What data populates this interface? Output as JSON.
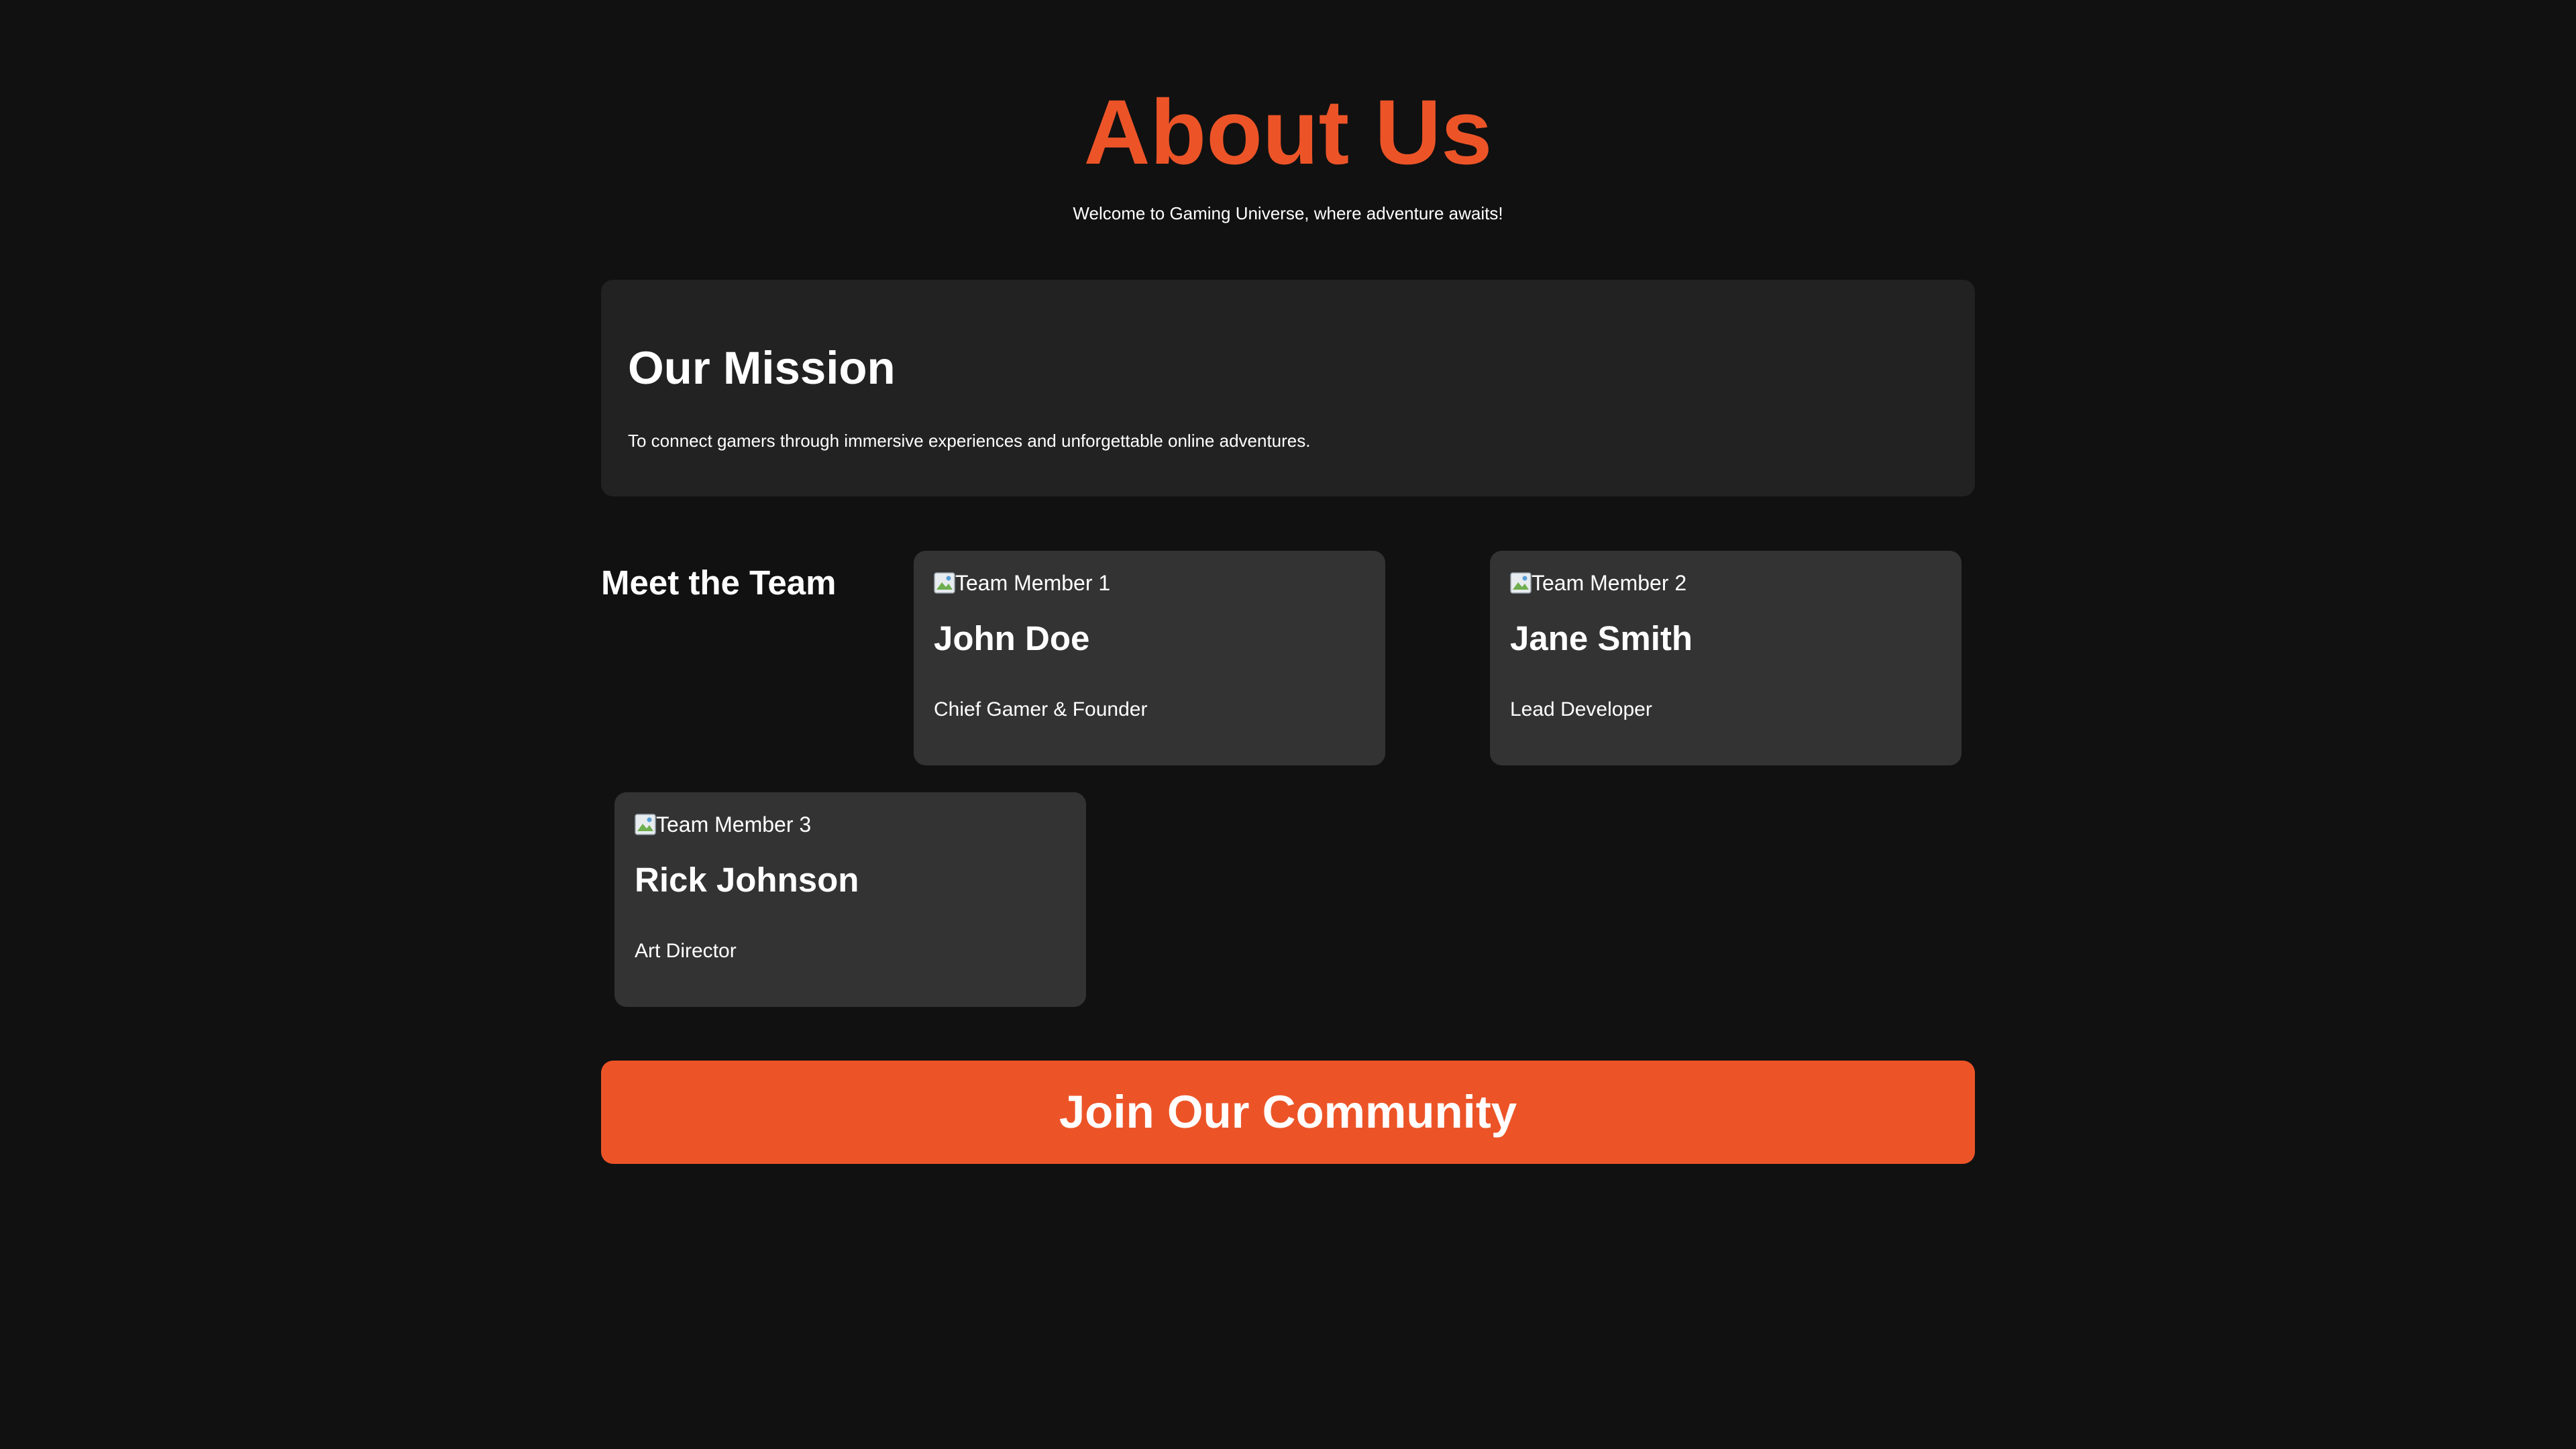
{
  "header": {
    "title": "About Us",
    "subtitle": "Welcome to Gaming Universe, where adventure awaits!"
  },
  "mission": {
    "heading": "Our Mission",
    "text": "To connect gamers through immersive experiences and unforgettable online adventures."
  },
  "team": {
    "heading": "Meet the Team",
    "members": [
      {
        "image_alt": "Team Member 1",
        "name": "John Doe",
        "role": "Chief Gamer & Founder"
      },
      {
        "image_alt": "Team Member 2",
        "name": "Jane Smith",
        "role": "Lead Developer"
      },
      {
        "image_alt": "Team Member 3",
        "name": "Rick Johnson",
        "role": "Art Director"
      }
    ]
  },
  "cta": {
    "label": "Join Our Community"
  },
  "colors": {
    "background": "#111111",
    "accent": "#ec5428",
    "card": "#222222",
    "member_card": "#333333",
    "text": "#ffffff"
  },
  "icons": {
    "member_photo": "broken-image-icon"
  }
}
